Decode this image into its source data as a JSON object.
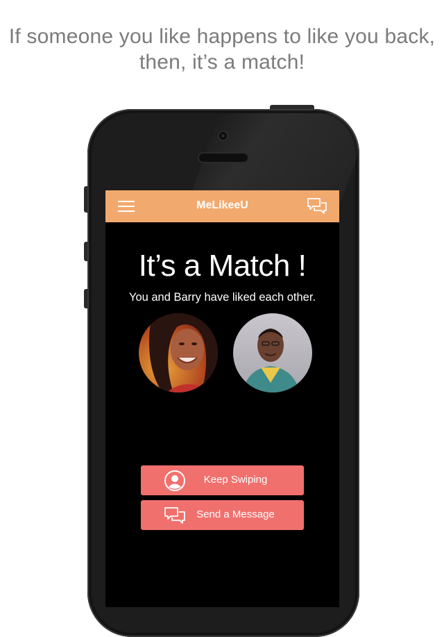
{
  "caption": {
    "line1": "If someone you like happens to like you back,",
    "line2": "then, it’s a match!"
  },
  "app": {
    "title": "MeLikeeU",
    "menu_icon": "hamburger-menu-icon",
    "messages_icon": "chat-bubbles-icon",
    "accent_color": "#f2a96e"
  },
  "match": {
    "heading": "It’s a Match !",
    "subtitle": "You and Barry have liked each other."
  },
  "actions": {
    "keep_swiping": "Keep Swiping",
    "send_message": "Send a Message",
    "button_color": "#f0706d"
  }
}
